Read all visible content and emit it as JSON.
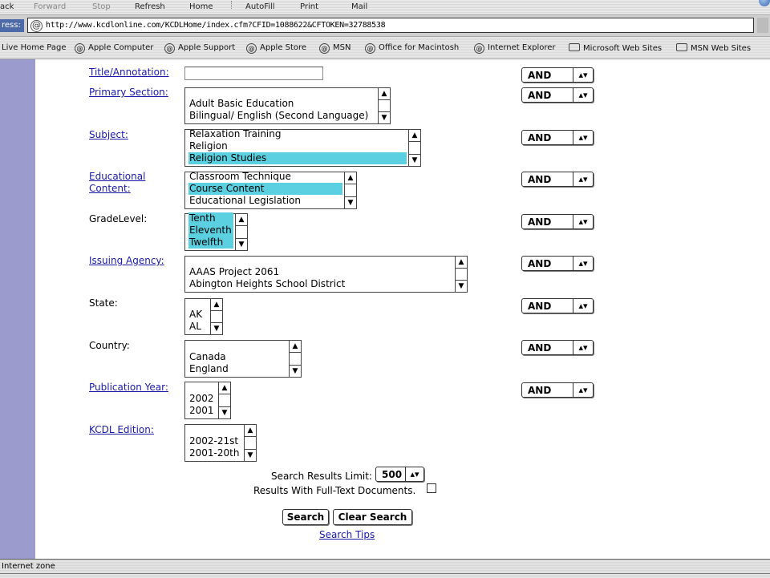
{
  "toolbar": {
    "back": "ack",
    "forward": "Forward",
    "stop": "Stop",
    "refresh": "Refresh",
    "home": "Home",
    "autofill": "AutoFill",
    "print": "Print",
    "mail": "Mail"
  },
  "address": {
    "label": "ress:",
    "url": "http://www.kcdlonline.com/KCDLHome/index.cfm?CFID=1088622&CFTOKEN=32788538"
  },
  "favorites": [
    "Live Home Page",
    "Apple Computer",
    "Apple Support",
    "Apple Store",
    "MSN",
    "Office for Macintosh",
    "Internet Explorer",
    "Microsoft Web Sites",
    "MSN Web Sites"
  ],
  "form": {
    "title_label": "Title/Annotation:",
    "title_value": "",
    "primary_label": "Primary Section:",
    "primary_options": [
      "Adult Basic Education",
      "Bilingual/ English (Second Language)"
    ],
    "subject_label": "Subject:",
    "subject_options": [
      "Relaxation Training",
      "Religion",
      "Religion Studies"
    ],
    "subject_selected": "Religion Studies",
    "edu_label_1": "Educational",
    "edu_label_2": "Content:",
    "edu_options": [
      "Classroom Technique",
      "Course Content",
      "Educational Legislation"
    ],
    "edu_selected": "Course Content",
    "grade_label": "GradeLevel:",
    "grade_options": [
      "Tenth",
      "Eleventh",
      "Twelfth"
    ],
    "issuing_label": "Issuing Agency:",
    "issuing_options": [
      "AAAS Project 2061",
      "Abington Heights School District"
    ],
    "state_label": "State:",
    "state_options": [
      "AK",
      "AL"
    ],
    "country_label": "Country:",
    "country_options": [
      "Canada",
      "England"
    ],
    "pubyear_label": "Publication Year:",
    "pubyear_options": [
      "2002",
      "2001"
    ],
    "edition_label": "KCDL Edition:",
    "edition_options": [
      "2002-21st",
      "2001-20th"
    ],
    "operator": "AND",
    "limit_label": "Search Results Limit:",
    "limit_value": "500",
    "fulltext_label": "Results With Full-Text Documents.",
    "fulltext_checked": false,
    "search_button": "Search",
    "clear_button": "Clear Search",
    "tips_link": "Search Tips"
  },
  "status": {
    "text": "Internet zone"
  }
}
